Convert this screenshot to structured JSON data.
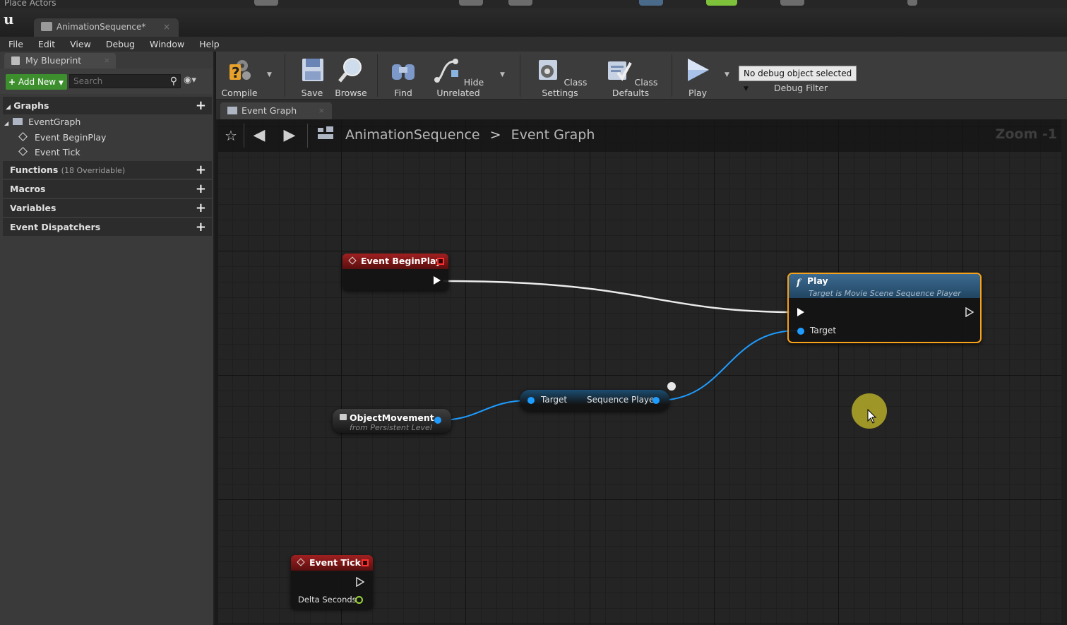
{
  "top_strip": {
    "tab_label": "Place Actors"
  },
  "document_tab": {
    "title": "AnimationSequence*",
    "close": "×"
  },
  "menu": [
    "File",
    "Edit",
    "View",
    "Debug",
    "Window",
    "Help"
  ],
  "my_blueprint": {
    "tab_label": "My Blueprint",
    "add_new_label": "Add New",
    "search_placeholder": "Search",
    "graphs_label": "Graphs",
    "event_graph_label": "EventGraph",
    "events": [
      "Event BeginPlay",
      "Event Tick"
    ],
    "functions_label": "Functions",
    "functions_count": "(18 Overridable)",
    "macros_label": "Macros",
    "variables_label": "Variables",
    "dispatchers_label": "Event Dispatchers"
  },
  "toolbar": {
    "compile": "Compile",
    "save": "Save",
    "browse": "Browse",
    "find": "Find",
    "hide_unrelated": "Hide Unrelated",
    "class_settings": "Class Settings",
    "class_defaults": "Class Defaults",
    "play": "Play",
    "debug_object": "No debug object selected",
    "debug_filter": "Debug Filter"
  },
  "graph_tab": {
    "label": "Event Graph"
  },
  "breadcrumb": {
    "root": "AnimationSequence",
    "separator": ">",
    "current": "Event Graph"
  },
  "zoom": "Zoom -1",
  "nodes": {
    "begin_play": {
      "title": "Event BeginPlay"
    },
    "play": {
      "title": "Play",
      "subtitle": "Target is Movie Scene Sequence Player",
      "target_pin": "Target"
    },
    "getter": {
      "in_pin": "Target",
      "out_pin": "Sequence Player"
    },
    "object_var": {
      "title": "ObjectMovement",
      "subtitle": "from Persistent Level"
    },
    "tick": {
      "title": "Event Tick",
      "delta_pin": "Delta Seconds"
    }
  },
  "colors": {
    "event_node_header": "#8b1a1a",
    "function_header": "#2f5c82",
    "selection_outline": "#f7a21b",
    "object_pin": "#1e9cff",
    "float_pin": "#9bd33a",
    "add_new_button": "#3d8f2e"
  }
}
